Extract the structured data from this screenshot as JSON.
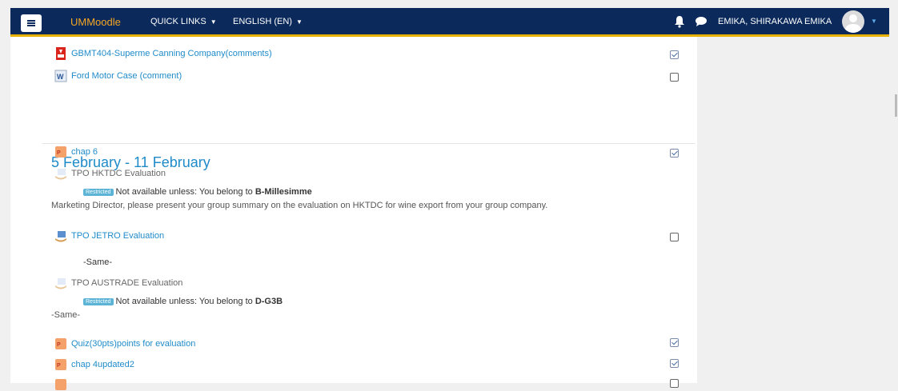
{
  "navbar": {
    "brand": "UMMoodle",
    "quick_links": "QUICK LINKS",
    "language": "ENGLISH (EN)",
    "user_name": "EMIKA, SHIRAKAWA EMIKA",
    "icons": [
      "menu-icon",
      "bell-icon",
      "chat-icon",
      "avatar"
    ]
  },
  "prev_section": {
    "items": [
      {
        "title": "GBMT404-Superme Canning Company(comments)",
        "icon": "pdf-icon",
        "completed": true
      },
      {
        "title": "Ford Motor Case (comment)",
        "icon": "word-icon",
        "completed": false
      }
    ]
  },
  "section": {
    "title": "5 February - 11 February",
    "item_chap6": "chap 6",
    "item_hktdc": "TPO HKTDC Evaluation",
    "restricted_badge": "Restricted",
    "hktdc_restriction_text": "Not available unless: You belong to",
    "hktdc_group": "B-Millesimme",
    "hktdc_description": "Marketing Director, please present your group summary on the evaluation on HKTDC for wine export from your group company.",
    "item_jetro": "TPO JETRO Evaluation",
    "jetro_description": "-Same-",
    "item_austrade": "TPO AUSTRADE Evaluation",
    "austrade_restriction_text": "Not available unless: You belong to",
    "austrade_group": "D-G3B",
    "austrade_description": "-Same-",
    "item_quiz": "Quiz(30pts)points for evaluation",
    "item_chap4": "chap 4updated2"
  },
  "completion": {
    "chap6": true,
    "jetro": false,
    "quiz": true,
    "chap4": true
  },
  "colors": {
    "navbar_bg": "#0b2a5b",
    "brand": "#f5a623",
    "accent_bar": "#e8b100",
    "link": "#1f8bc9",
    "restricted_badge": "#5bb3d6"
  }
}
